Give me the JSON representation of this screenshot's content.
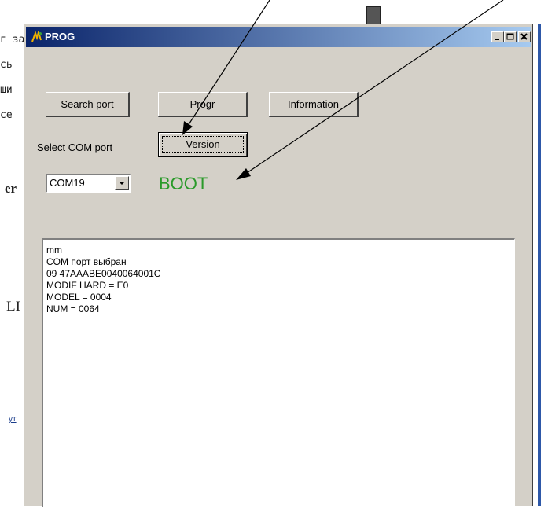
{
  "background": {
    "fragments": [
      "г за",
      "сь",
      "ши",
      "се"
    ],
    "bold_fragment": "er",
    "large_fragment": "LI",
    "link_fragment": "ут"
  },
  "window": {
    "title": "PROG",
    "buttons": {
      "search_port": "Search port",
      "progr": "Progr",
      "information": "Information",
      "version": "Version"
    },
    "select_label": "Select COM port",
    "com_port": {
      "selected": "COM19"
    },
    "status": "BOOT",
    "log": [
      "mm",
      "COM порт выбран",
      "09 47AAABE0040064001C",
      "MODIF HARD = E0",
      "MODEL = 0004",
      "NUM = 0064"
    ]
  },
  "colors": {
    "title_gradient_start": "#0a246a",
    "title_gradient_end": "#a6caf0",
    "window_face": "#d4d0c8",
    "status_green": "#2a9a2a",
    "right_bar": "#2e58a8"
  },
  "icons": [
    "app-icon",
    "minimize-icon",
    "maximize-icon",
    "close-icon",
    "dropdown-arrow-icon",
    "pointer-arrow-icon"
  ]
}
